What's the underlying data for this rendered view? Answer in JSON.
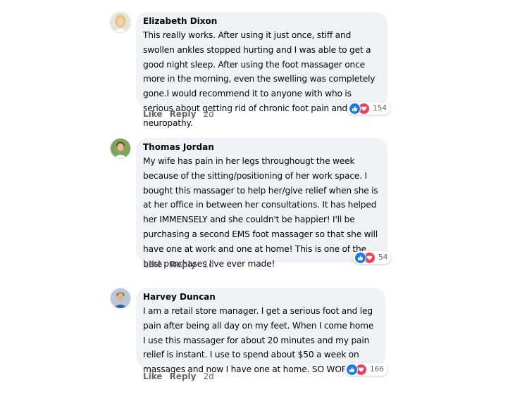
{
  "comments": [
    {
      "author": "Elizabeth Dixon",
      "text": "This really works. After using it just once, stiff and swollen ankles stopped hurting and I was able to get a good night sleep. After using the foot massager once more in the morning, even the swelling was completely gone.I would recommend it to anyone with who is serious about getting rid of chronic foot pain and neuropathy.",
      "reaction_count": "154",
      "like_label": "Like",
      "reply_label": "Reply",
      "time": "2d",
      "avatar_colors": {
        "bg": "#e8e4dc",
        "hair": "#e3c77a",
        "skin": "#f3d2b8",
        "shirt": "#ffffff"
      }
    },
    {
      "author": "Thomas Jordan",
      "text": "My wife has pain in her legs throughougt the week because of the  sitting/positioning of her work space. I bought this massager to help her/give relief when she is at her office in between her consultations. It has helped her IMMENSELY and she couldn't be happier! I'll be purchasing a second EMS foot massager so that she will have one at work and one at home! This is one of the best purchases I've ever made!",
      "reaction_count": "54",
      "like_label": "Like",
      "reply_label": "Reply",
      "time": "1d",
      "avatar_colors": {
        "bg": "#7fa45c",
        "hair": "#5b3a22",
        "skin": "#e9b995",
        "shirt": "#ffffff"
      }
    },
    {
      "author": "Harvey Duncan",
      "text": "I am a retail store manager. I get a serious foot and leg pain after being all day on my feet. When I come home I use this massager for about 20 minutes and my pain relief is instant. I use to spend about $50 a week on massages and now I have one at home. SO WORTH IT!!",
      "reaction_count": "166",
      "like_label": "Like",
      "reply_label": "Reply",
      "time": "2d",
      "avatar_colors": {
        "bg": "#b9c8d6",
        "hair": "#6b5a4a",
        "skin": "#e6b28e",
        "shirt": "#2d5ea8"
      }
    }
  ],
  "colors": {
    "like": "#1877f2",
    "love": "#f33e58",
    "bubble": "#f0f2f5",
    "meta": "#65676b"
  },
  "icons": {
    "like": "thumbs-up-icon",
    "love": "heart-icon"
  }
}
